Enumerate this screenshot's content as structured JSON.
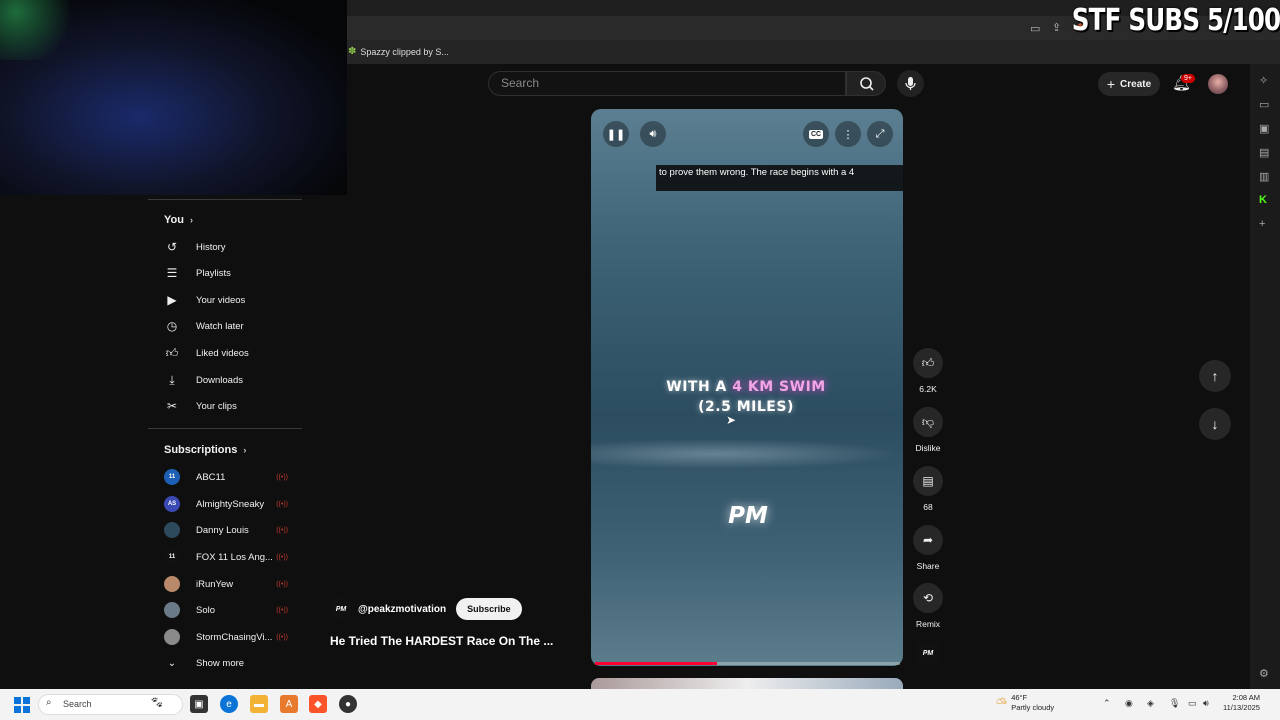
{
  "stream_overlay": {
    "text": "STF SUBS 5/100"
  },
  "bookmarks": [
    {
      "label": "Spazzy clipped by S..."
    }
  ],
  "header": {
    "search_placeholder": "Search",
    "create_label": "Create",
    "notification_badge": "9+"
  },
  "guide": {
    "you_section": {
      "title": "You",
      "items": [
        {
          "label": "History",
          "icon": "history-icon"
        },
        {
          "label": "Playlists",
          "icon": "playlists-icon"
        },
        {
          "label": "Your videos",
          "icon": "your-videos-icon"
        },
        {
          "label": "Watch later",
          "icon": "watch-later-icon"
        },
        {
          "label": "Liked videos",
          "icon": "liked-videos-icon"
        },
        {
          "label": "Downloads",
          "icon": "download-icon"
        },
        {
          "label": "Your clips",
          "icon": "scissors-icon"
        }
      ]
    },
    "subscriptions": {
      "title": "Subscriptions",
      "items": [
        {
          "name": "ABC11",
          "avatar": "11",
          "color": "#1d5fb4"
        },
        {
          "name": "AlmightySneaky",
          "avatar": "AS",
          "color": "#3a4ab5"
        },
        {
          "name": "Danny Louis",
          "avatar": "",
          "color": "#2d4a5c"
        },
        {
          "name": "FOX 11 Los Ang...",
          "avatar": "11",
          "color": "#111111"
        },
        {
          "name": "iRunYew",
          "avatar": "",
          "color": "#b98a6a"
        },
        {
          "name": "Solo",
          "avatar": "",
          "color": "#6a7a88"
        },
        {
          "name": "StormChasingVi...",
          "avatar": "",
          "color": "#8a8a8a"
        }
      ],
      "show_more": "Show more"
    }
  },
  "short": {
    "caption": "to prove them wrong. The race begins with a 4",
    "overlay_line1_prefix": "WITH A ",
    "overlay_line1_highlight": "4 KM SWIM",
    "overlay_line2": "(2.5 MILES)",
    "watermark": "PM",
    "cc_label": "CC",
    "progress_fraction": 0.4,
    "channel_logo": "PM",
    "channel_handle": "@peakzmotivation",
    "subscribe_label": "Subscribe",
    "title": "He Tried The HARDEST Race On The ..."
  },
  "actions": {
    "like_count": "6.2K",
    "dislike_label": "Dislike",
    "comment_count": "68",
    "share_label": "Share",
    "remix_label": "Remix",
    "audio_logo": "PM"
  },
  "taskbar": {
    "search_label": "Search",
    "weather_temp": "46°F",
    "weather_desc": "Partly cloudy",
    "time": "2:08 AM",
    "date": "11/13/2025"
  }
}
